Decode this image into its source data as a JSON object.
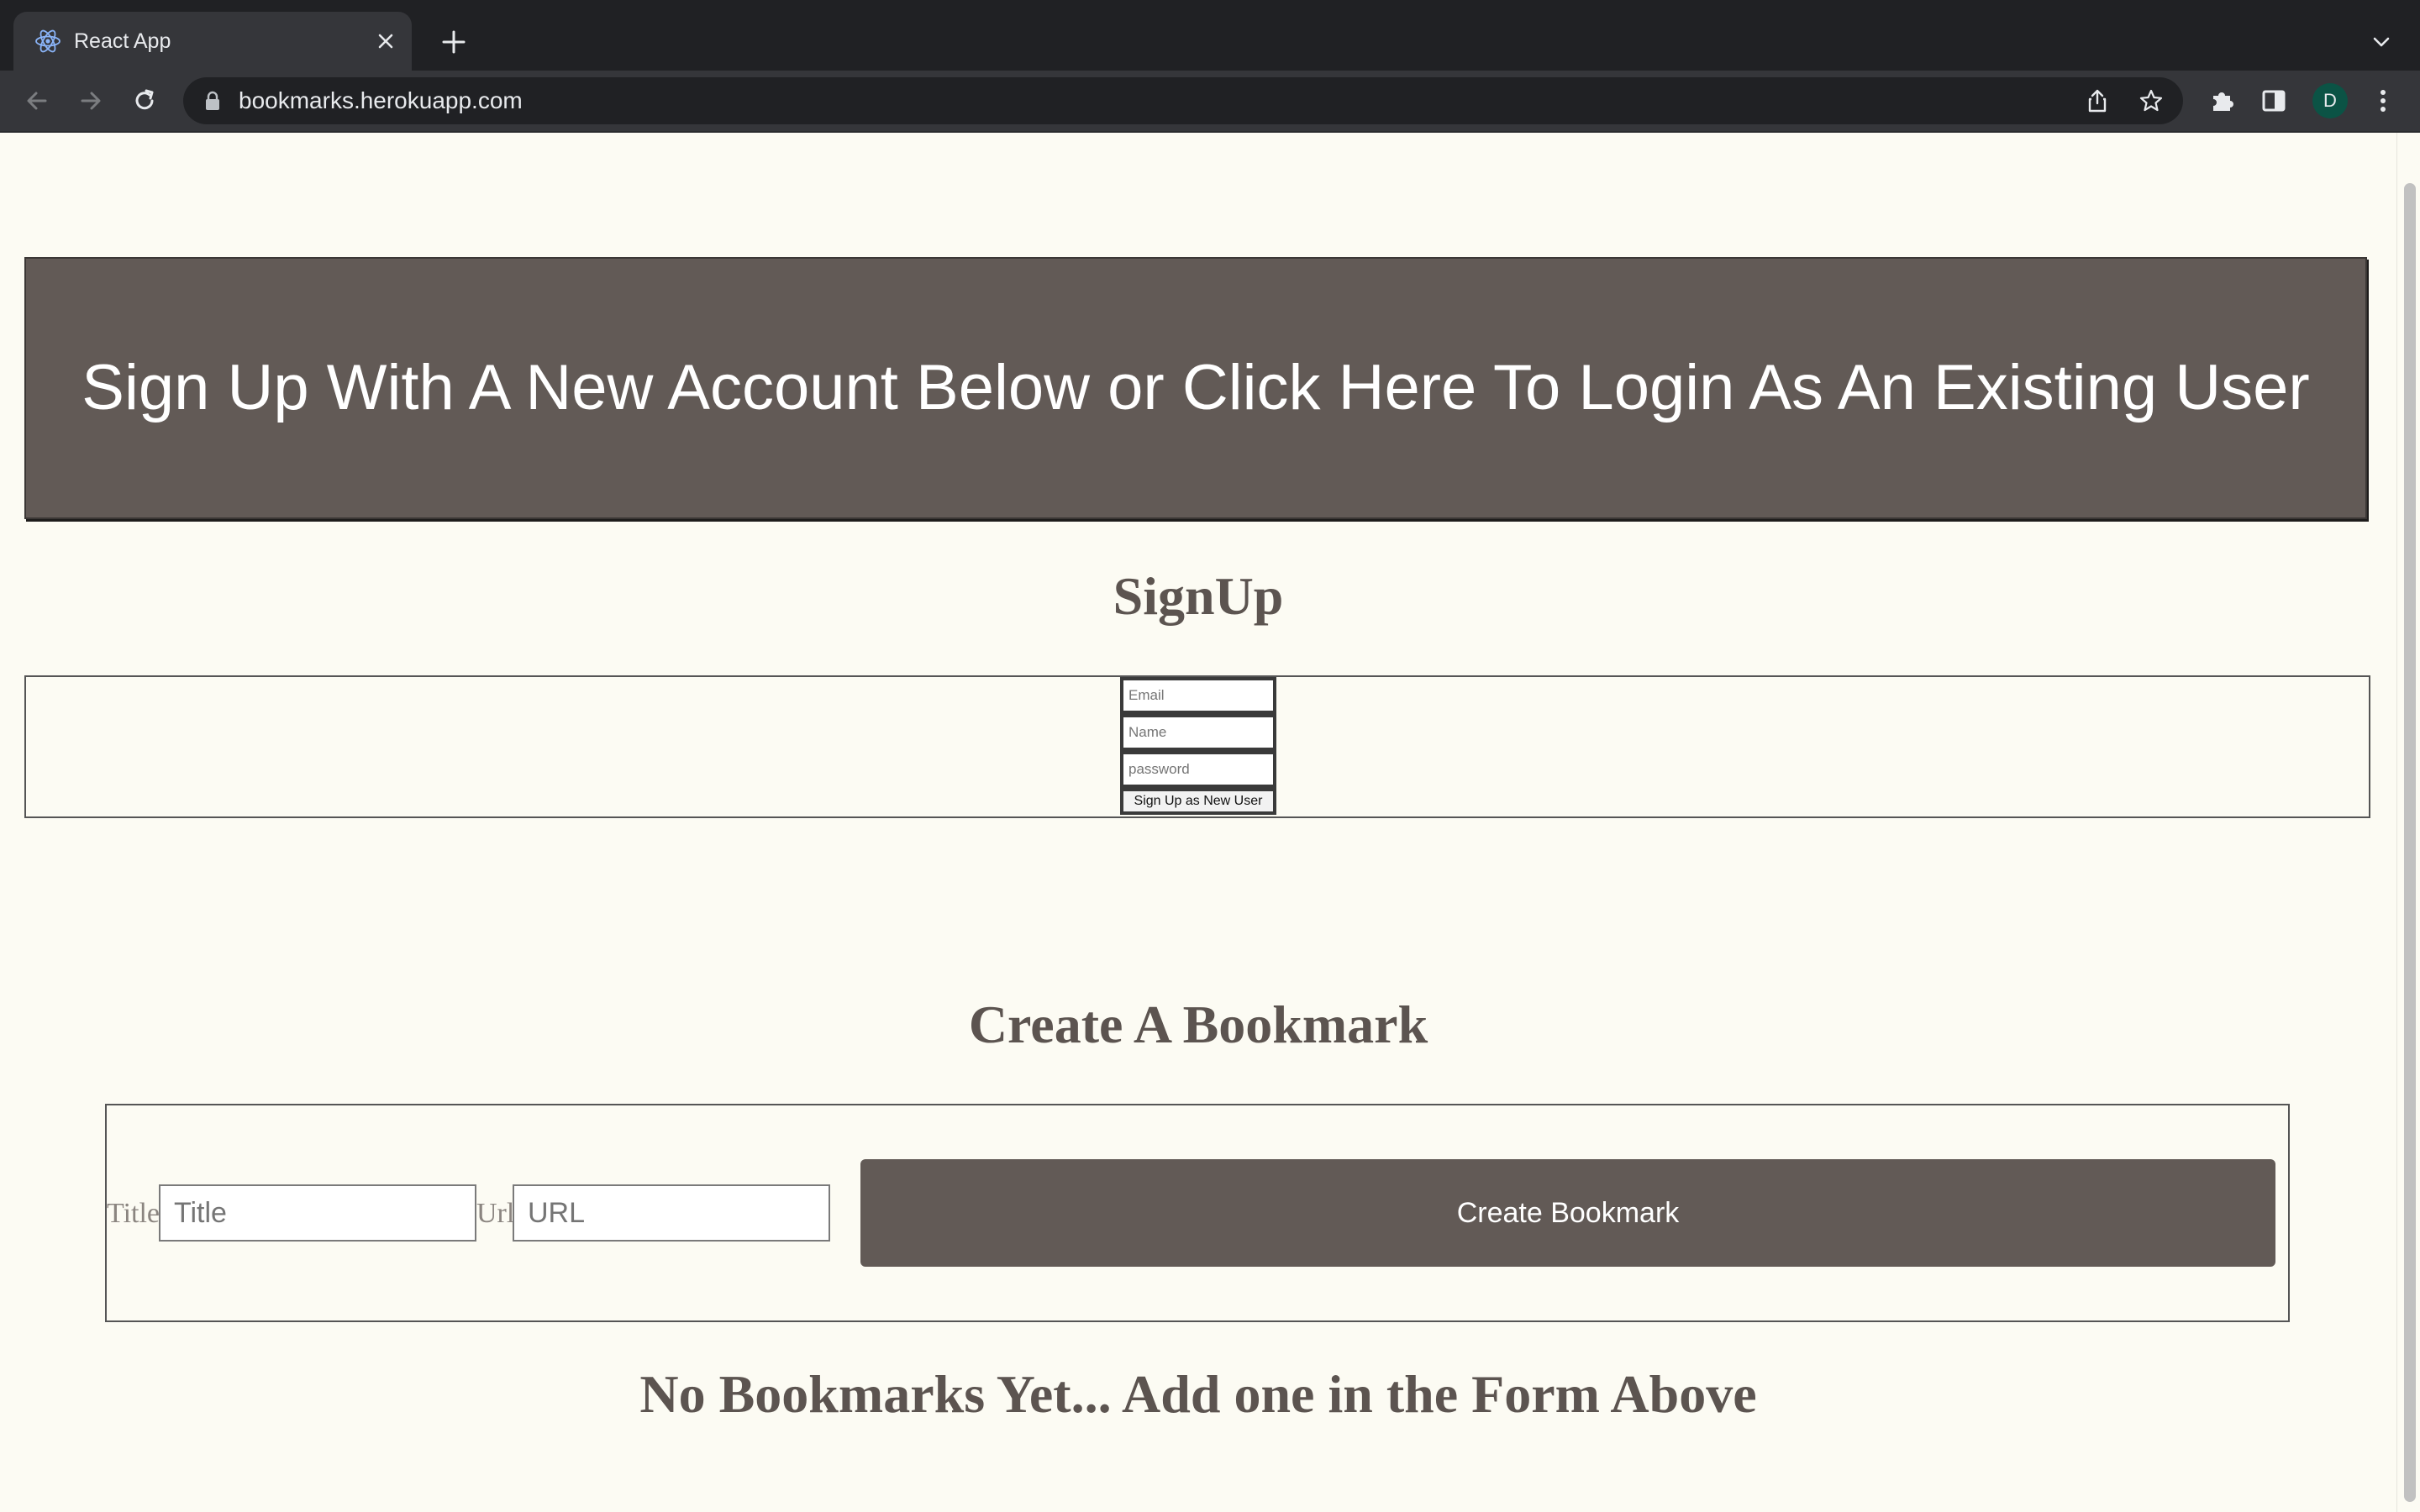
{
  "browser": {
    "tab_title": "React App",
    "url": "bookmarks.herokuapp.com",
    "profile_initial": "D"
  },
  "page": {
    "banner_text": "Sign Up With A New Account Below or Click Here To Login As An Existing User",
    "signup_heading": "SignUp",
    "signup": {
      "email_placeholder": "Email",
      "name_placeholder": "Name",
      "password_placeholder": "password",
      "submit_label": "Sign Up as New User"
    },
    "create_heading": "Create A Bookmark",
    "bookmark_form": {
      "title_label": "Title",
      "title_placeholder": "Title",
      "url_label": "Url",
      "url_placeholder": "URL",
      "submit_label": "Create Bookmark"
    },
    "empty_message": "No Bookmarks Yet... Add one in the Form Above"
  },
  "colors": {
    "page_background": "#fcfbf3",
    "banner_background": "#625a56",
    "heading_text": "#5c5450",
    "chrome_dark": "#202124",
    "chrome_toolbar": "#35363a"
  }
}
